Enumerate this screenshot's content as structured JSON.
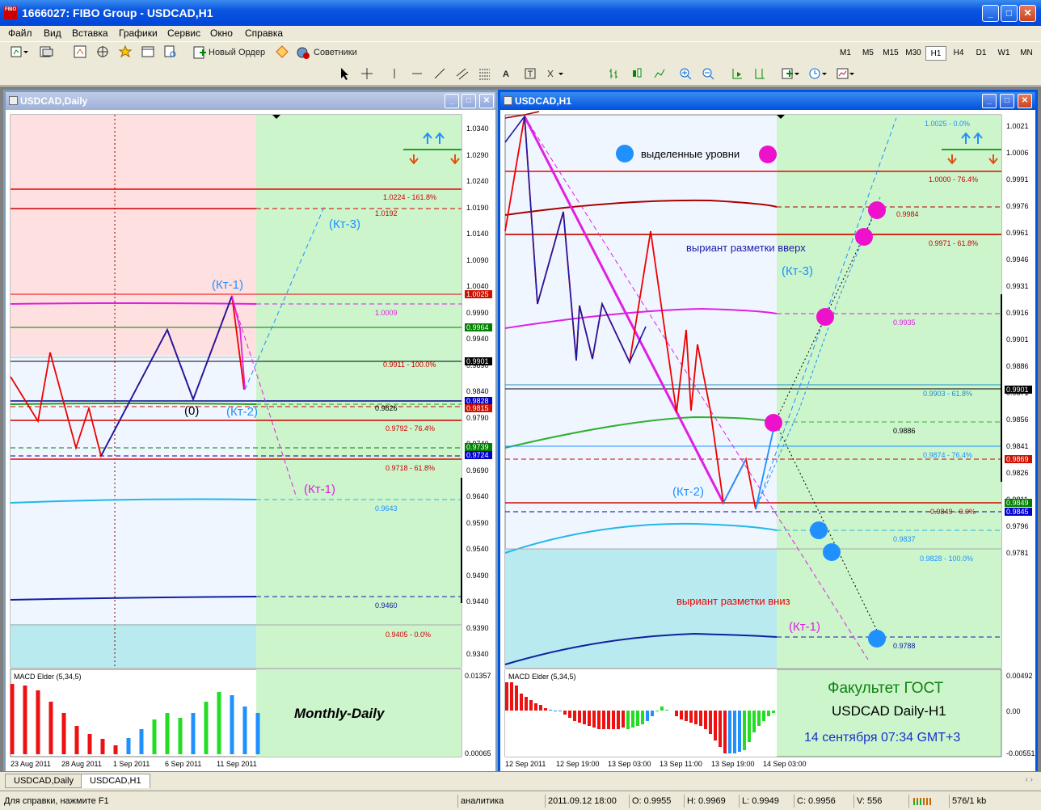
{
  "app": {
    "title": "1666027: FIBO Group - USDCAD,H1"
  },
  "menu": [
    "Файл",
    "Вид",
    "Вставка",
    "Графики",
    "Сервис",
    "Окно",
    "Справка"
  ],
  "toolbar": {
    "new_order": "Новый Ордер",
    "experts": "Советники",
    "text_tool": "A",
    "timeframes": [
      "M1",
      "M5",
      "M15",
      "M30",
      "H1",
      "H4",
      "D1",
      "W1",
      "MN"
    ],
    "active_timeframe": "H1"
  },
  "left_chart": {
    "title": "USDCAD,Daily",
    "price_axis": [
      "1.0340",
      "1.0290",
      "1.0240",
      "1.0190",
      "1.0140",
      "1.0090",
      "1.0040",
      "0.9990",
      "0.9940",
      "0.9890",
      "0.9840",
      "0.9790",
      "0.9740",
      "0.9690",
      "0.9640",
      "0.9590",
      "0.9540",
      "0.9490",
      "0.9440",
      "0.9390",
      "0.9340"
    ],
    "price_tags": [
      {
        "text": "1.0025",
        "bg": "#cc1100"
      },
      {
        "text": "0.9964",
        "bg": "#008000"
      },
      {
        "text": "0.9901",
        "bg": "#000000"
      },
      {
        "text": "0.9828",
        "bg": "#0000cc"
      },
      {
        "text": "0.9815",
        "bg": "#cc1100"
      },
      {
        "text": "0.9739",
        "bg": "#008000"
      },
      {
        "text": "0.9724",
        "bg": "#0000cc"
      }
    ],
    "level_labels": [
      "1.0224 - 161.8%",
      "1.0192",
      "1.0009",
      "0.9911 - 100.0%",
      "0.9826",
      "0.9792 - 76.4%",
      "0.9718 - 61.8%",
      "0.9643",
      "0.9460",
      "0.9405 - 0.0%"
    ],
    "annotations": [
      "(Кт-3)",
      "(Кт-1)",
      "(0)",
      "(Кт-2)",
      "(Кт-1)"
    ],
    "time_axis": [
      "23 Aug 2011",
      "28 Aug 2011",
      "1 Sep 2011",
      "6 Sep 2011",
      "11 Sep 2011"
    ],
    "macd": {
      "label": "MACD Elder (5,34,5)",
      "caption": "Monthly-Daily",
      "axis": [
        "0.01357",
        "0.00065"
      ]
    }
  },
  "right_chart": {
    "title": "USDCAD,H1",
    "price_axis": [
      "1.0021",
      "1.0006",
      "0.9991",
      "0.9976",
      "0.9961",
      "0.9946",
      "0.9931",
      "0.9916",
      "0.9901",
      "0.9886",
      "0.9871",
      "0.9856",
      "0.9841",
      "0.9826",
      "0.9811",
      "0.9796",
      "0.9781"
    ],
    "price_tags": [
      {
        "text": "0.9901",
        "bg": "#000000"
      },
      {
        "text": "0.9869",
        "bg": "#cc1100"
      },
      {
        "text": "0.9849",
        "bg": "#008000"
      },
      {
        "text": "0.9845",
        "bg": "#0000cc"
      }
    ],
    "level_labels": [
      "1.0025 - 0.0%",
      "1.0000 - 76.4%",
      "0.9984",
      "0.9971 - 61.8%",
      "0.9935",
      "0.9903 - 61.8%",
      "0.9886",
      "0.9874 - 76.4%",
      "0.9849 - 0.0%",
      "0.9837",
      "0.9828 - 100.0%",
      "0.9788"
    ],
    "legend_text": "выделенные уровни",
    "up_text": "выриант разметки вверх",
    "down_text": "выриант разметки вниз",
    "annotations": [
      "(Кт-3)",
      "(Кт-2)",
      "(Кт-1)"
    ],
    "time_axis": [
      "12 Sep 2011",
      "12 Sep 19:00",
      "13 Sep 03:00",
      "13 Sep 11:00",
      "13 Sep 19:00",
      "14 Sep 03:00"
    ],
    "macd": {
      "label": "MACD Elder (5,34,5)",
      "axis": [
        "0.00492",
        "0.00",
        "-0.00551"
      ]
    },
    "info": {
      "faculty": "Факультет ГОСТ",
      "pair": "USDCAD Daily-H1",
      "date": "14 сентября 07:34 GMT+3"
    }
  },
  "tabs": [
    "USDCAD,Daily",
    "USDCAD,H1"
  ],
  "status": {
    "help": "Для справки, нажмите F1",
    "profile": "аналитика",
    "datetime": "2011.09.12 18:00",
    "open": "O: 0.9955",
    "high": "H: 0.9969",
    "low": "L: 0.9949",
    "close": "C: 0.9956",
    "volume": "V: 556",
    "traffic": "576/1 kb"
  }
}
